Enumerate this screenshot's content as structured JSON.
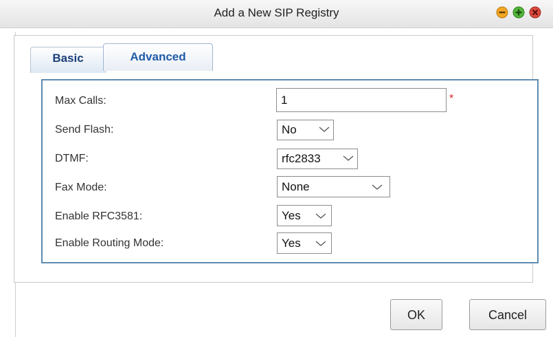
{
  "window": {
    "title": "Add a New SIP Registry"
  },
  "tabs": [
    {
      "label": "Basic"
    },
    {
      "label": "Advanced",
      "active": true
    }
  ],
  "form": {
    "max_calls": {
      "label": "Max Calls:",
      "value": "1",
      "required_mark": "*"
    },
    "send_flash": {
      "label": "Send Flash:",
      "value": "No"
    },
    "dtmf": {
      "label": "DTMF:",
      "value": "rfc2833"
    },
    "fax_mode": {
      "label": "Fax Mode:",
      "value": "None"
    },
    "enable_rfc3581": {
      "label": "Enable RFC3581:",
      "value": "Yes"
    },
    "enable_routing_mode": {
      "label": "Enable Routing Mode:",
      "value": "Yes"
    }
  },
  "buttons": {
    "ok": "OK",
    "cancel": "Cancel"
  },
  "icons": {
    "minimize": "minimize-icon",
    "maximize": "maximize-icon",
    "close": "close-icon"
  },
  "colors": {
    "minimize": "#f0a020",
    "maximize": "#4caf32",
    "close": "#d9453a",
    "accent_border": "#5d8bb0",
    "tab_text": "#1f5ba8"
  }
}
